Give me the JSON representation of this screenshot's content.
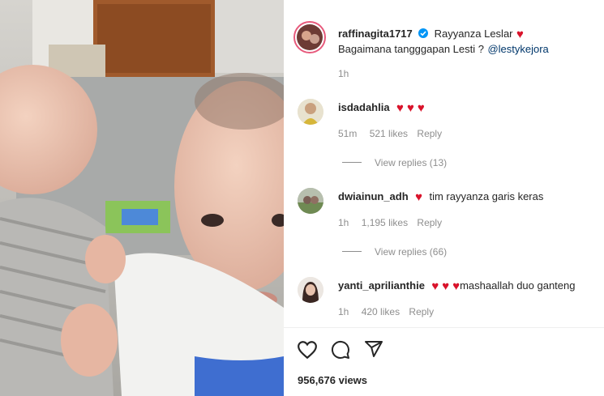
{
  "post": {
    "username": "raffinagita1717",
    "tagged_name": "Rayyanza Leslar",
    "caption_text": "Bagaimana tangggapan Lesti ?",
    "mention": "@lestykejora",
    "time": "1h",
    "verified_icon": "verified-badge-icon",
    "views": "956,676 views"
  },
  "comments": [
    {
      "username": "isdadahlia",
      "text": "",
      "hearts": 3,
      "time": "51m",
      "likes": "521 likes",
      "reply": "Reply",
      "view_replies": "View replies (13)"
    },
    {
      "username": "dwiainun_adh",
      "text": "tim rayyanza garis keras",
      "hearts": 1,
      "time": "1h",
      "likes": "1,195 likes",
      "reply": "Reply",
      "view_replies": "View replies (66)"
    },
    {
      "username": "yanti_aprilianthie",
      "text": "mashaallah duo ganteng",
      "hearts": 3,
      "time": "1h",
      "likes": "420 likes",
      "reply": "Reply"
    }
  ],
  "actions": [
    "heart-icon",
    "comment-icon",
    "share-icon"
  ],
  "colors": {
    "heart": "#d9132b",
    "verified": "#0095f6",
    "muted": "#8e8e8e",
    "text": "#262626"
  }
}
